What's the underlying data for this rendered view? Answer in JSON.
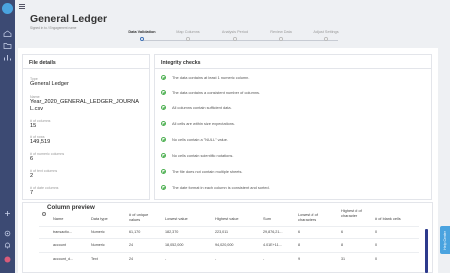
{
  "app": {
    "title": "General Ledger",
    "subtitle": "Signed in to / Engagement name"
  },
  "stepper": {
    "steps": [
      {
        "label": "Data Validation",
        "active": true
      },
      {
        "label": "Map Columns",
        "active": false
      },
      {
        "label": "Analysis Period",
        "active": false
      },
      {
        "label": "Review Data",
        "active": false
      },
      {
        "label": "Adjust Settings",
        "active": false
      }
    ]
  },
  "file_details": {
    "heading": "File details",
    "fields": [
      {
        "label": "Type",
        "value": "General Ledger"
      },
      {
        "label": "Name",
        "value": "Year_2020_GENERAL_LEDGER_JOURNAL.csv"
      },
      {
        "label": "# of columns",
        "value": "15"
      },
      {
        "label": "# of rows",
        "value": "149,519"
      },
      {
        "label": "# of numeric columns",
        "value": "6"
      },
      {
        "label": "# of text columns",
        "value": "2"
      },
      {
        "label": "# of date columns",
        "value": "7"
      }
    ]
  },
  "integrity": {
    "heading": "Integrity checks",
    "checks": [
      "The data contains at least 1 numeric column.",
      "The data contains a consistent number of columns.",
      "All columns contain sufficient data.",
      "All cells are within size expectations.",
      "No cells contain a \"NULL\" value.",
      "No cells contain scientific notations.",
      "The file does not contain multiple sheets.",
      "The date format in each column is consistent and sorted."
    ]
  },
  "preview": {
    "heading": "Column preview",
    "headers": [
      "Name",
      "Data type",
      "# of unique values",
      "Lowest value",
      "Highest value",
      "Sum",
      "Lowest # of characters",
      "Highest # of character",
      "# of blank cells"
    ],
    "rows": [
      [
        "transactio...",
        "Numeric",
        "61,170",
        "182,370",
        "223,011",
        "29,876,21...",
        "6",
        "6",
        "0"
      ],
      [
        "account",
        "Numeric",
        "24",
        "18,052,000",
        "94,020,000",
        "4.01E+11...",
        "8",
        "8",
        "0"
      ],
      [
        "account_d...",
        "Text",
        "24",
        "-",
        "-",
        "-",
        "9",
        "31",
        "0"
      ]
    ]
  },
  "side_tab": {
    "label": "Help Center"
  },
  "colors": {
    "rail": "#3c4a73",
    "accent": "#4aa3df",
    "check": "#4caf50",
    "scroll": "#2d3a8c"
  },
  "icons": [
    "app-logo-icon",
    "menu-icon",
    "home-icon",
    "folder-icon",
    "chart-icon",
    "add-icon",
    "settings-icon",
    "notification-icon",
    "user-icon",
    "check-circle-icon"
  ]
}
